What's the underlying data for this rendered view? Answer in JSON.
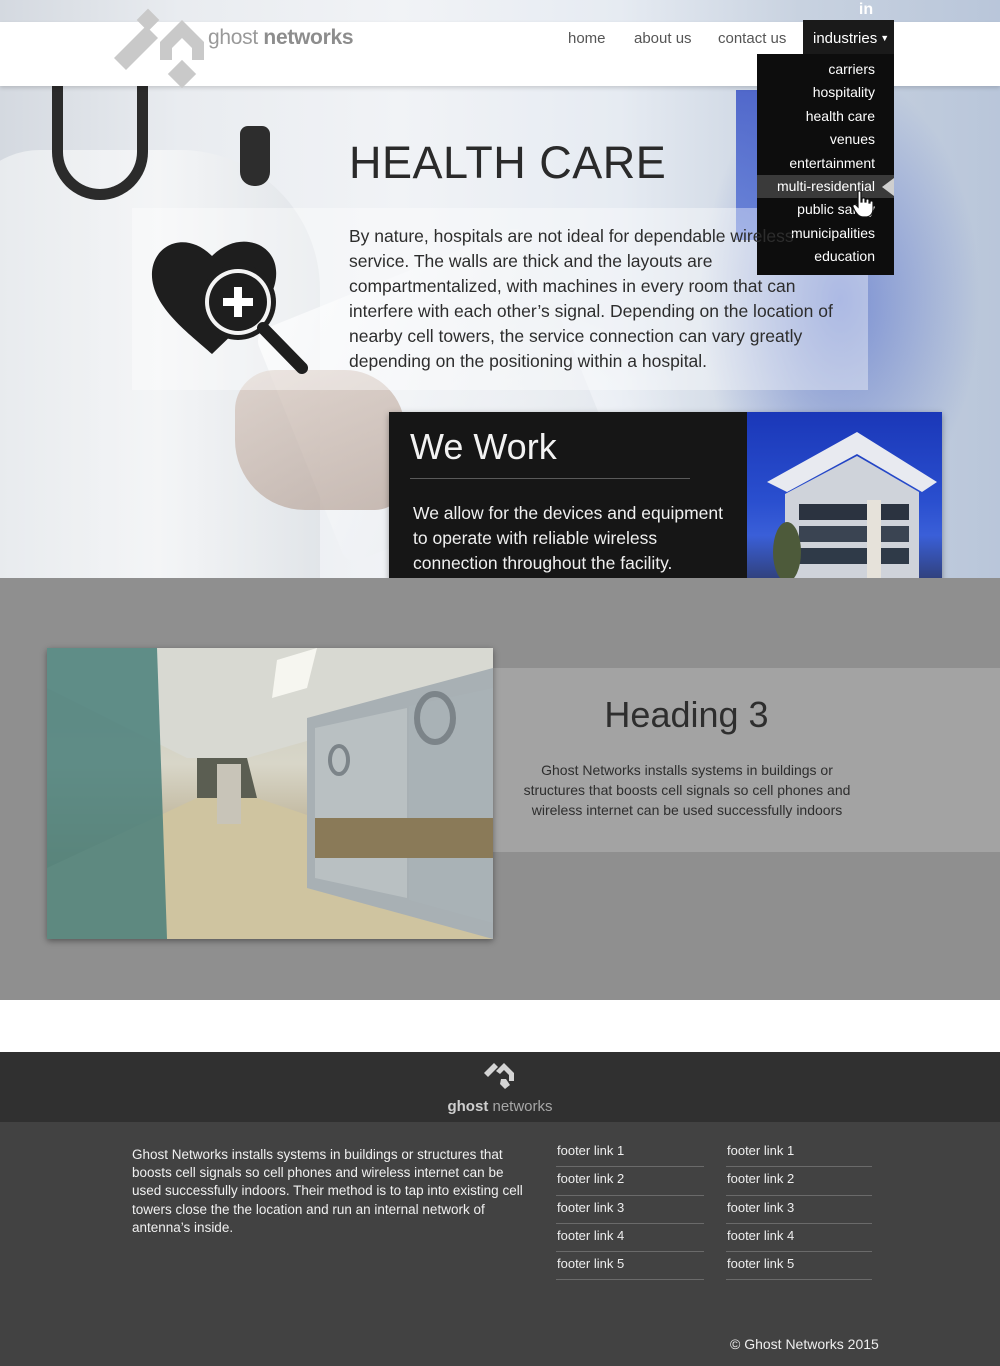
{
  "header": {
    "logo_light": "ghost ",
    "logo_bold": "networks",
    "social_icon": "linkedin-icon",
    "social_label": "in"
  },
  "nav": {
    "items": [
      "home",
      "about us",
      "contact us"
    ],
    "industries_label": "industries",
    "dropdown": [
      "carriers",
      "hospitality",
      "health care",
      "venues",
      "entertainment",
      "multi-residential",
      "public safety",
      "municipalities",
      "education"
    ],
    "dropdown_active": "multi-residential"
  },
  "hero": {
    "title": "HEALTH CARE",
    "body": "By nature, hospitals are not ideal for dependable wireless service. The walls are thick and the layouts are compartmentalized, with machines in every room that can interfere with each other’s signal. Depending on the location of nearby cell towers, the service connection can vary greatly depending on the positioning within a hospital.",
    "icon": "heart-magnifier-plus-icon"
  },
  "work_card": {
    "title": "We Work",
    "body": "We allow for the devices and equipment to operate with reliable wireless connection throughout the facility."
  },
  "feature": {
    "heading": "Heading 3",
    "body": "Ghost Networks installs systems in buildings or structures that boosts cell signals so cell phones and wireless internet can be used successfully indoors"
  },
  "footer": {
    "logo_bold": "ghost ",
    "logo_light": "networks",
    "about": "Ghost Networks installs systems in buildings or structures that boosts cell signals so cell phones and wireless internet can be used successfully indoors. Their method is to tap into existing cell towers close the the location and run an internal network of antenna’s inside.",
    "col1": [
      "footer link 1",
      "footer link 2",
      "footer link 3",
      "footer link 4",
      "footer link 5"
    ],
    "col2": [
      "footer link 1",
      "footer link 2",
      "footer link 3",
      "footer link 4",
      "footer link 5"
    ],
    "copyright": "© Ghost Networks 2015"
  },
  "colors": {
    "nav_active_bg": "#1a1a1a",
    "grey_band": "#8f8f8f",
    "footer_top": "#303030",
    "footer_main": "#424242"
  }
}
